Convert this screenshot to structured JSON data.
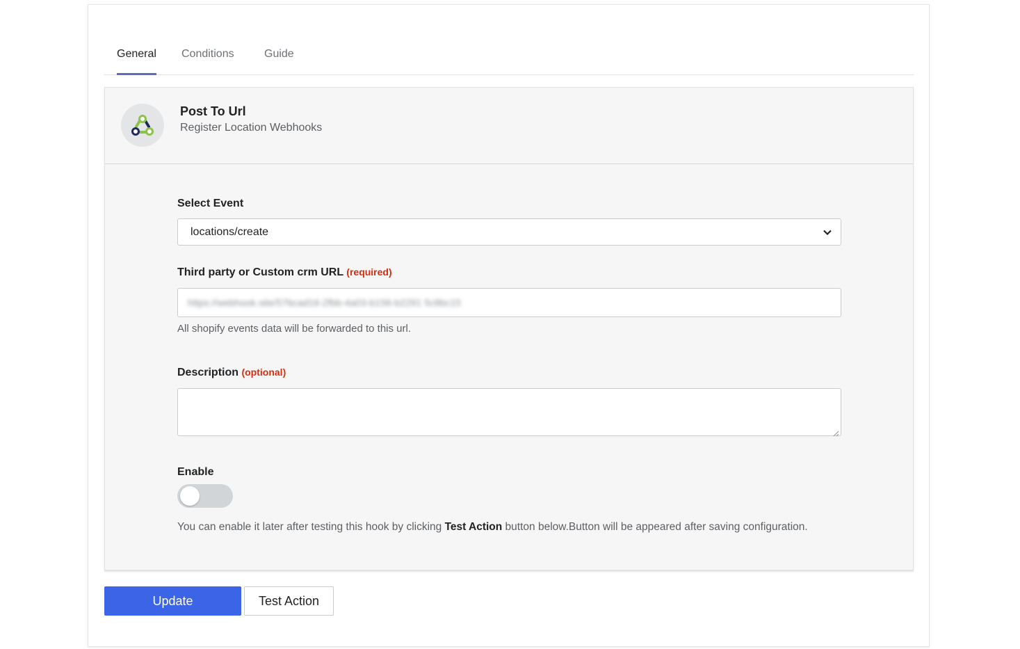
{
  "tabs": [
    {
      "label": "General",
      "active": true
    },
    {
      "label": "Conditions",
      "active": false
    },
    {
      "label": "Guide",
      "active": false
    }
  ],
  "header": {
    "title": "Post To Url",
    "subtitle": "Register Location Webhooks",
    "logo_icon": "webhook-icon"
  },
  "form": {
    "event": {
      "label": "Select Event",
      "selected": "locations/create"
    },
    "url": {
      "label": "Third party or Custom crm URL",
      "tag": "(required)",
      "value": "https://webhook.site/57bcad16-2fbb-4a03-b156-b2291 5c8bc15",
      "help": "All shopify events data will be forwarded to this url."
    },
    "description": {
      "label": "Description",
      "tag": "(optional)",
      "value": ""
    },
    "enable": {
      "label": "Enable",
      "on": false,
      "help_before": "You can enable it later after testing this hook by clicking ",
      "help_bold": "Test Action",
      "help_after": " button below.Button will be appeared after saving configuration."
    }
  },
  "buttons": {
    "update": "Update",
    "test_action": "Test Action"
  },
  "colors": {
    "accent": "#3c64e6",
    "tab_underline": "#5c6ac4",
    "required": "#d72c0d",
    "panel_bg": "#f6f6f7"
  }
}
